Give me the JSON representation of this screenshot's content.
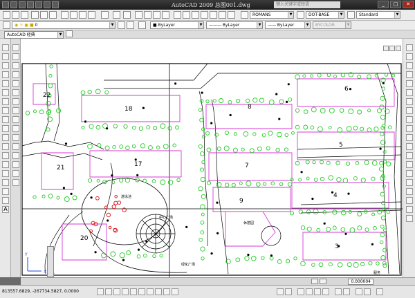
{
  "app": {
    "title": "AutoCAD 2009  总图001.dwg",
    "search_placeholder": "键入关键字或短语"
  },
  "toolbar_standard": {
    "text_style": "ROMANS",
    "dim_style": "DOT-BASE",
    "table_style": "Standard"
  },
  "toolbar_layers": {
    "layer": "0",
    "color": "ByLayer",
    "linetype": "ByLayer",
    "lineweight": "ByLayer",
    "plotstyle": "BYCOLOR"
  },
  "workspace": {
    "name": "AutoCAD 经典"
  },
  "drawing": {
    "building_labels": [
      "22",
      "18",
      "8",
      "6",
      "5",
      "21",
      "17",
      "7",
      "9",
      "4",
      "20",
      "3"
    ],
    "annotations": [
      "游泳池",
      "中心广场",
      "绿化广场",
      "休憩园",
      "服务"
    ]
  },
  "viewport": {
    "scale": "0.000004"
  },
  "status": {
    "coordinates": "813557.6829, -267734.5827, 0.0000"
  }
}
